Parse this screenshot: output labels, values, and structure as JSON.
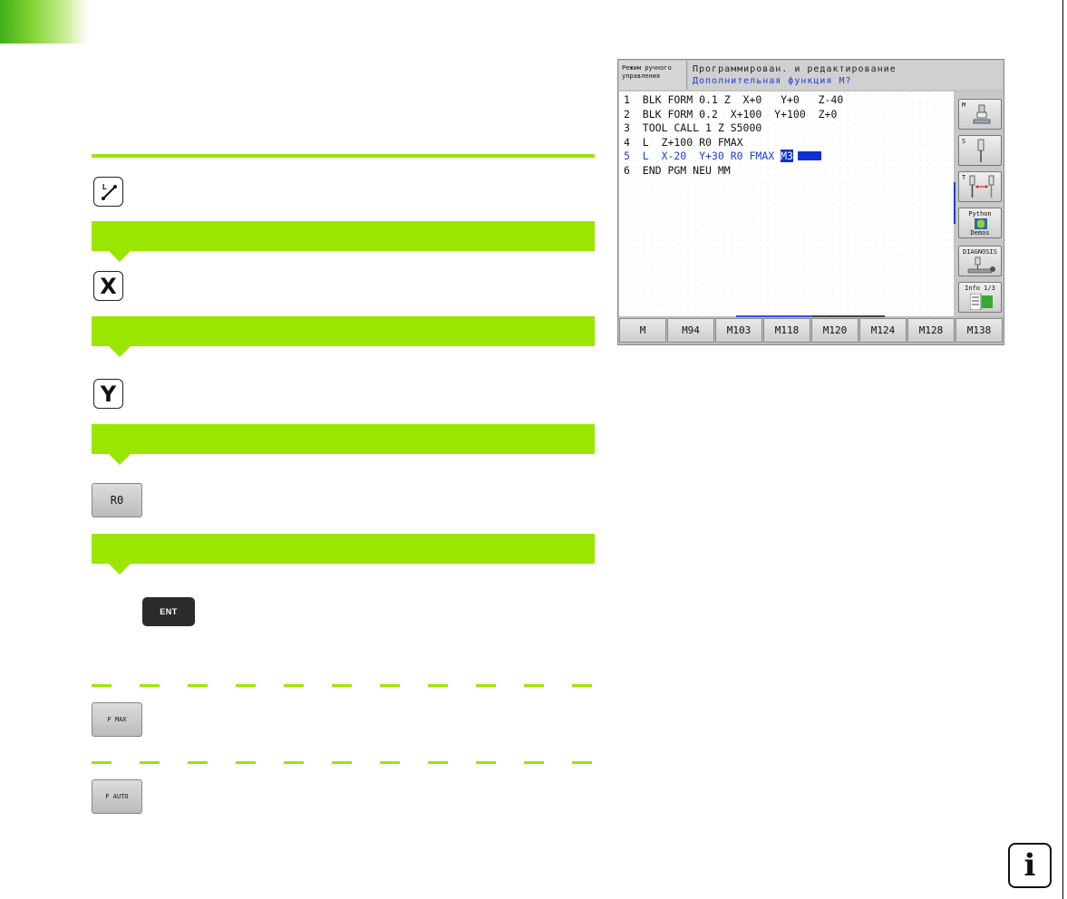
{
  "keys": {
    "line_key_label": "L",
    "x_key": "X",
    "y_key": "Y",
    "r0_key": "R0",
    "ent_key": "ENT",
    "fmax_key": "F MAX",
    "fauto_key": "F AUTO"
  },
  "screen": {
    "mode_label_line1": "Режим ручного",
    "mode_label_line2": "управления",
    "title_line1": "Программирован. и редактирование",
    "title_line2": "Дополнительная функция М?",
    "program_lines": [
      "1  BLK FORM 0.1 Z  X+0   Y+0   Z-40",
      "2  BLK FORM 0.2  X+100  Y+100  Z+0",
      "3  TOOL CALL 1 Z S5000",
      "4  L  Z+100 R0 FMAX",
      "5  L  X-20  Y+30 R0 FMAX ",
      "6  END PGM NEU MM"
    ],
    "active_highlight": "M3",
    "side_buttons": {
      "m_label": "M",
      "s_label": "S",
      "t_label": "T",
      "python_line1": "Python",
      "python_line2": "Demos",
      "diagnosis": "DIAGNOSIS",
      "info": "Info 1/3"
    },
    "softkeys": [
      "M",
      "M94",
      "M103",
      "M118",
      "M120",
      "M124",
      "M128",
      "M138"
    ]
  },
  "info_icon": "i"
}
